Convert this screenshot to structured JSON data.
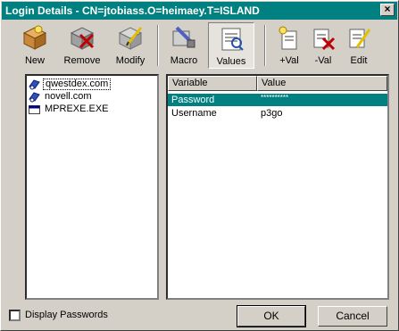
{
  "window": {
    "title": "Login Details - CN=jtobiass.O=heimaey.T=ISLAND"
  },
  "toolbar": {
    "new_label": "New",
    "remove_label": "Remove",
    "modify_label": "Modify",
    "macro_label": "Macro",
    "values_label": "Values",
    "add_val_label": "+Val",
    "remove_val_label": "-Val",
    "edit_label": "Edit"
  },
  "tree": {
    "items": [
      {
        "label": "qwestdex.com",
        "icon": "server-icon"
      },
      {
        "label": "novell.com",
        "icon": "server-icon"
      },
      {
        "label": "MPREXE.EXE",
        "icon": "window-icon"
      }
    ]
  },
  "list": {
    "columns": [
      "Variable",
      "Value"
    ],
    "rows": [
      {
        "variable": "Password",
        "value": "**********"
      },
      {
        "variable": "Username",
        "value": "p3go"
      }
    ]
  },
  "options": {
    "display_passwords_label": "Display Passwords",
    "display_passwords_checked": false
  },
  "buttons": {
    "ok_label": "OK",
    "cancel_label": "Cancel"
  },
  "colors": {
    "titlebar": "#008080",
    "selection": "#008080",
    "face": "#d4d0c8"
  }
}
